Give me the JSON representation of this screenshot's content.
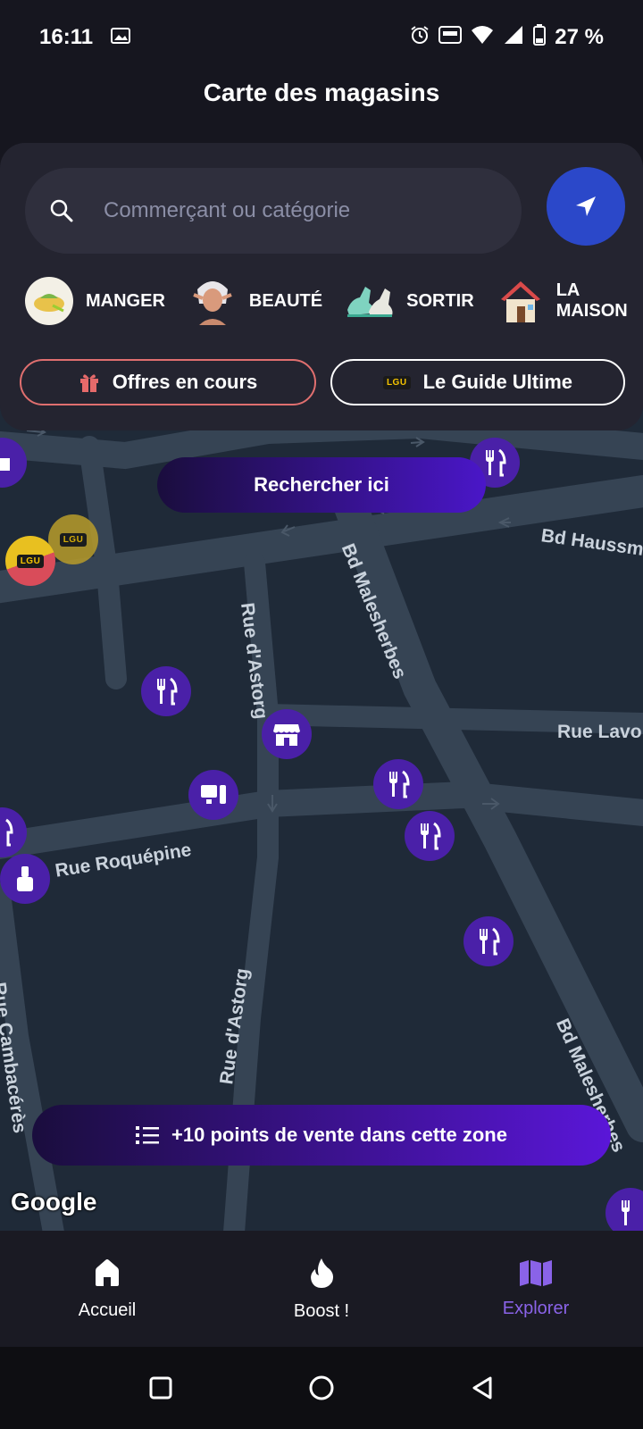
{
  "status_bar": {
    "time": "16:11",
    "battery": "27 %"
  },
  "header": {
    "title": "Carte des magasins"
  },
  "search": {
    "placeholder": "Commerçant ou catégorie"
  },
  "categories": [
    {
      "label": "MANGER",
      "icon": "food-icon"
    },
    {
      "label": "BEAUTÉ",
      "icon": "beauty-icon"
    },
    {
      "label": "SORTIR",
      "icon": "shoes-icon"
    },
    {
      "label": "LA MAISON",
      "icon": "house-icon"
    }
  ],
  "pills": {
    "offers": "Offres en cours",
    "guide": "Le Guide Ultime",
    "guide_badge": "LGU"
  },
  "map": {
    "search_here": "Rechercher ici",
    "zone_button": "+10 points de vente dans cette zone",
    "attribution": "Google",
    "streets": [
      "Bd Haussm",
      "Bd Malesherbes",
      "Rue d'Astorg",
      "Rue Lavo",
      "Rue Roquépine",
      "Rue Cambacérès",
      "Rue d'Astorg",
      "Bd Malesherbes"
    ],
    "lgu_badge": "LGU"
  },
  "nav": {
    "home": "Accueil",
    "boost": "Boost !",
    "explore": "Explorer"
  },
  "colors": {
    "accent": "#4a20a8",
    "active_nav": "#8a63e8",
    "locate": "#2b48c9",
    "offers_border": "#e06f6f"
  }
}
